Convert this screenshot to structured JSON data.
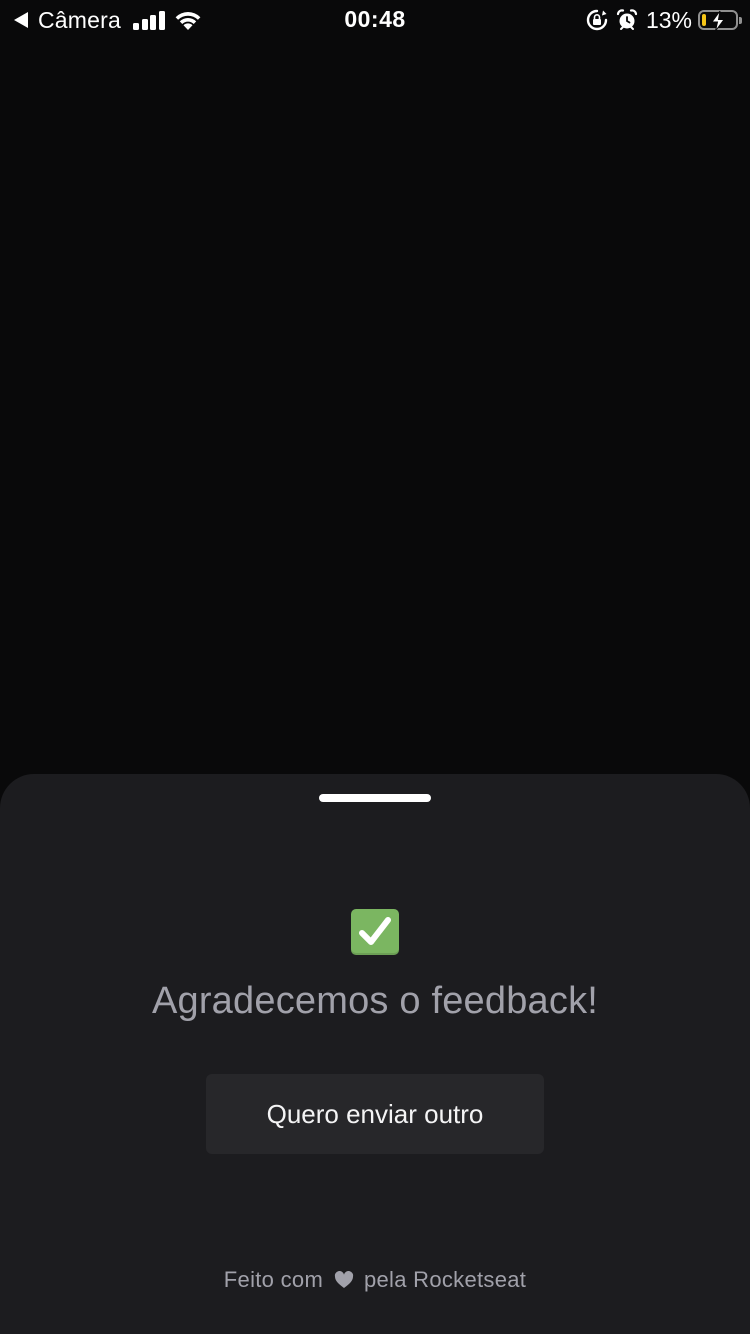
{
  "status_bar": {
    "back_label": "Câmera",
    "time": "00:48",
    "battery_percent": "13%",
    "battery_level": 0.13,
    "charging": true
  },
  "sheet": {
    "success_icon": "check-mark-button-icon",
    "title": "Agradecemos o feedback!",
    "button_label": "Quero enviar outro",
    "footer_prefix": "Feito com",
    "footer_icon": "heart-icon",
    "footer_suffix": "pela Rocketseat"
  },
  "colors": {
    "background": "#09090a",
    "sheet": "#1c1c1f",
    "button": "#27272a",
    "muted_text": "#a1a1aa",
    "success": "#7bb661",
    "battery": "#f5c518"
  }
}
